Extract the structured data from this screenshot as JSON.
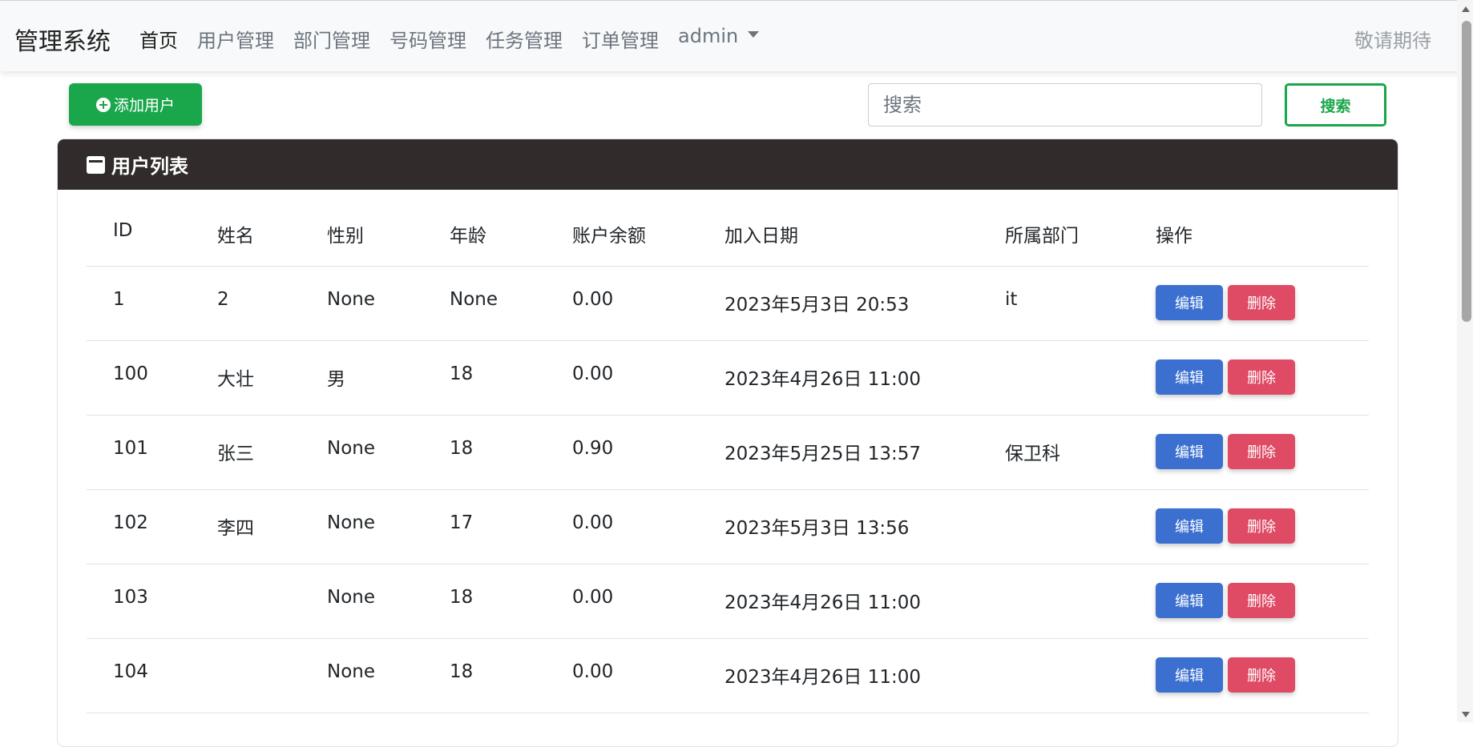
{
  "navbar": {
    "brand": "管理系统",
    "items": [
      {
        "label": "首页",
        "active": true
      },
      {
        "label": "用户管理",
        "active": false
      },
      {
        "label": "部门管理",
        "active": false
      },
      {
        "label": "号码管理",
        "active": false
      },
      {
        "label": "任务管理",
        "active": false
      },
      {
        "label": "订单管理",
        "active": false
      }
    ],
    "user_menu": "admin",
    "right_text": "敬请期待"
  },
  "toolbar": {
    "add_label": "添加用户",
    "search_placeholder": "搜索",
    "search_value": "",
    "search_button": "搜索"
  },
  "panel": {
    "title": "用户列表",
    "columns": [
      "ID",
      "姓名",
      "性别",
      "年龄",
      "账户余额",
      "加入日期",
      "所属部门",
      "操作"
    ],
    "edit_label": "编辑",
    "delete_label": "删除",
    "rows": [
      {
        "id": "1",
        "name": "2",
        "gender": "None",
        "age": "None",
        "balance": "0.00",
        "date": "2023年5月3日 20:53",
        "dept": "it"
      },
      {
        "id": "100",
        "name": "大壮",
        "gender": "男",
        "age": "18",
        "balance": "0.00",
        "date": "2023年4月26日 11:00",
        "dept": ""
      },
      {
        "id": "101",
        "name": "张三",
        "gender": "None",
        "age": "18",
        "balance": "0.90",
        "date": "2023年5月25日 13:57",
        "dept": "保卫科"
      },
      {
        "id": "102",
        "name": "李四",
        "gender": "None",
        "age": "17",
        "balance": "0.00",
        "date": "2023年5月3日 13:56",
        "dept": ""
      },
      {
        "id": "103",
        "name": "",
        "gender": "None",
        "age": "18",
        "balance": "0.00",
        "date": "2023年4月26日 11:00",
        "dept": ""
      },
      {
        "id": "104",
        "name": "",
        "gender": "None",
        "age": "18",
        "balance": "0.00",
        "date": "2023年4月26日 11:00",
        "dept": ""
      }
    ]
  },
  "colors": {
    "success": "#1aa64a",
    "primary": "#3b6fd0",
    "danger": "#df4a64",
    "panel_header": "#312c2b",
    "navbar_bg": "#f8f9fa"
  }
}
